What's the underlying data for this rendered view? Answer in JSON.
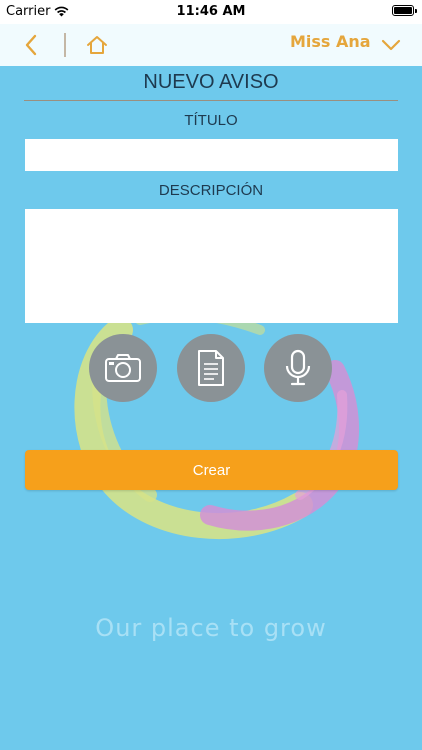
{
  "status_bar": {
    "carrier": "Carrier",
    "time": "11:46 AM"
  },
  "nav": {
    "user_name": "Miss Ana",
    "accent_color": "#e5a63c"
  },
  "form": {
    "title": "NUEVO AVISO",
    "title_label": "TÍTULO",
    "title_value": "",
    "description_label": "DESCRIPCIÓN",
    "description_value": "",
    "attachments": [
      {
        "icon": "camera-icon"
      },
      {
        "icon": "document-icon"
      },
      {
        "icon": "microphone-icon"
      }
    ],
    "submit_label": "Crear",
    "submit_color": "#f6a01b"
  },
  "branding": {
    "tagline": "Our place to grow",
    "background_color": "#6ec9ec"
  }
}
